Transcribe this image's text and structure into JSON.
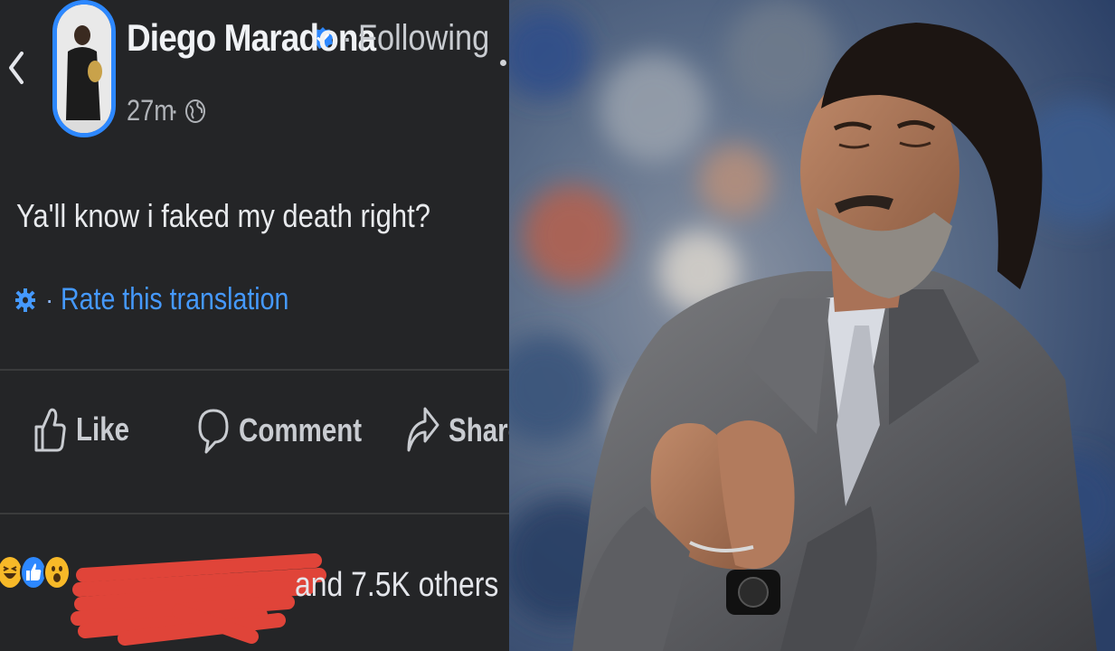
{
  "post": {
    "author": "Diego Maradona",
    "follow_status": "Following",
    "separator": "·",
    "timestamp": "27m",
    "text": "Ya'll know i faked my death right?",
    "translation_link": "Rate this translation",
    "actions": {
      "like": "Like",
      "comment": "Comment",
      "share": "Share"
    },
    "reactions": {
      "summary_text": "and 7.5K others",
      "icons": [
        "haha-icon",
        "like-icon",
        "wow-icon"
      ]
    }
  },
  "colors": {
    "background": "#242527",
    "link_blue": "#4599ff",
    "verified_blue": "#2d88ff",
    "redaction_red": "#e8463a"
  },
  "photo": {
    "subject": "man-in-grey-suit-clapping"
  }
}
